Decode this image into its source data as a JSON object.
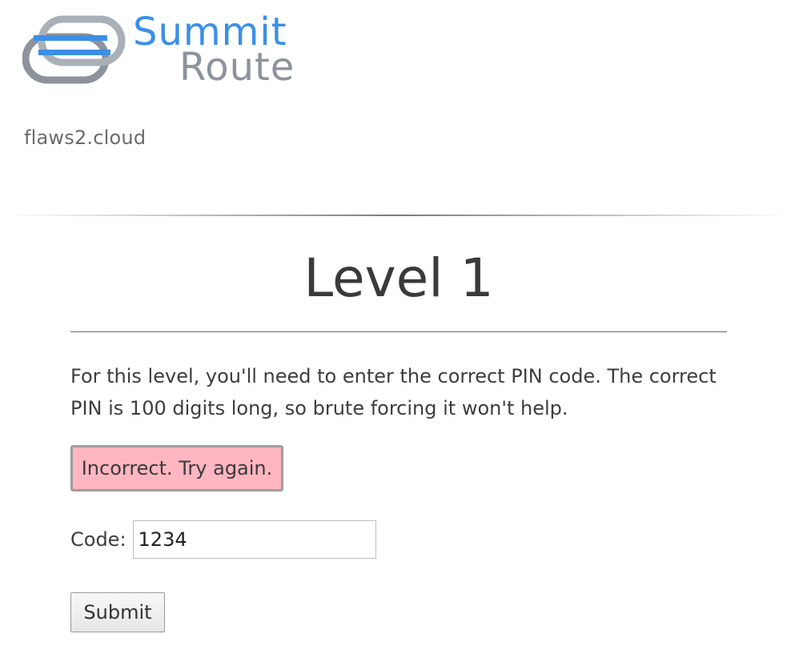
{
  "logo": {
    "icon": "summit-route-link-icon",
    "line1": "Summit",
    "line2": "Route",
    "colors": {
      "blue": "#3b8fe6",
      "gray": "#8d939c"
    }
  },
  "site": {
    "name": "flaws2.cloud"
  },
  "level": {
    "title": "Level 1",
    "intro": "For this level, you'll need to enter the correct PIN code. The correct PIN is 100 digits long, so brute forcing it won't help."
  },
  "error": {
    "message": "Incorrect. Try again.",
    "background": "#ffb6c1"
  },
  "form": {
    "code_label": "Code:",
    "code_value": "1234",
    "submit_label": "Submit"
  }
}
